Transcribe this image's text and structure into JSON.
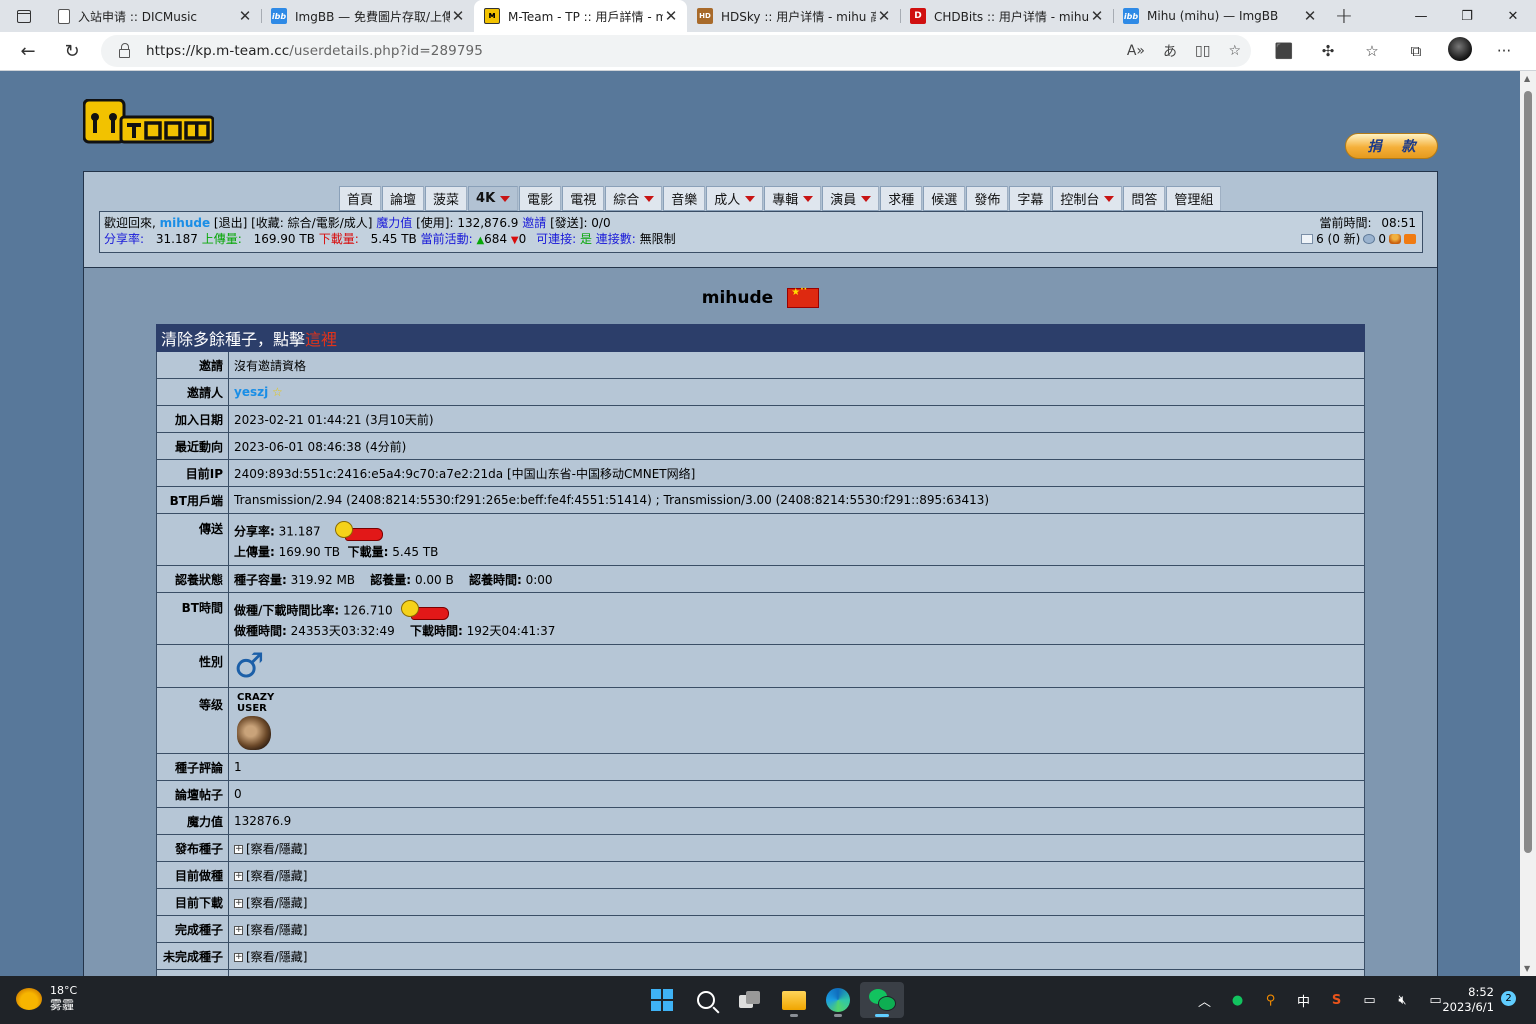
{
  "browser": {
    "tabs": [
      {
        "title": "入站申请 :: DICMusic",
        "favicon": "doc-icon",
        "active": false
      },
      {
        "title": "ImgBB — 免費圖片存取/上傳",
        "favicon": "imgbb-icon",
        "active": false
      },
      {
        "title": "M-Team - TP :: 用戶詳情 - mihude",
        "favicon": "mteam-icon",
        "active": true
      },
      {
        "title": "HDSky :: 用户详情 - mihu 高清",
        "favicon": "hdsky-icon",
        "active": false
      },
      {
        "title": "CHDBits :: 用户详情 - mihu",
        "favicon": "chdbits-icon",
        "active": false
      },
      {
        "title": "Mihu (mihu) — ImgBB",
        "favicon": "imgbb-icon",
        "active": false
      }
    ],
    "url_host": "https://kp.m-team.cc",
    "url_path": "/userdetails.php?id=289795"
  },
  "site": {
    "donate_a": "捐",
    "donate_b": "款",
    "menu": [
      {
        "label": "首頁",
        "dropdown": false,
        "selected": false
      },
      {
        "label": "論壇",
        "dropdown": false,
        "selected": false
      },
      {
        "label": "菠菜",
        "dropdown": false,
        "selected": false
      },
      {
        "label": "4K",
        "dropdown": true,
        "selected": true
      },
      {
        "label": "電影",
        "dropdown": false,
        "selected": false
      },
      {
        "label": "電視",
        "dropdown": false,
        "selected": false
      },
      {
        "label": "綜合",
        "dropdown": true,
        "selected": false
      },
      {
        "label": "音樂",
        "dropdown": false,
        "selected": false
      },
      {
        "label": "成人",
        "dropdown": true,
        "selected": false
      },
      {
        "label": "專輯",
        "dropdown": true,
        "selected": false
      },
      {
        "label": "演員",
        "dropdown": true,
        "selected": false
      },
      {
        "label": "求種",
        "dropdown": false,
        "selected": false
      },
      {
        "label": "候選",
        "dropdown": false,
        "selected": false
      },
      {
        "label": "發佈",
        "dropdown": false,
        "selected": false
      },
      {
        "label": "字幕",
        "dropdown": false,
        "selected": false
      },
      {
        "label": "控制台",
        "dropdown": true,
        "selected": false
      },
      {
        "label": "問答",
        "dropdown": false,
        "selected": false
      },
      {
        "label": "管理組",
        "dropdown": false,
        "selected": false
      }
    ]
  },
  "infobar": {
    "welcome": "歡迎回來,",
    "username": "mihude",
    "logout": "[退出]",
    "fav": "[收藏: 綜合/電影/成人]",
    "bonus_label": "魔力值",
    "bonus_used": "[使用]: 132,876.9",
    "invite_label": "邀請",
    "invite_sent": "[發送]: 0/0",
    "ratio_label": "分享率:",
    "ratio": "31.187",
    "up_label": "上傳量:",
    "up": "169.90 TB",
    "down_label": "下載量:",
    "down": "5.45 TB",
    "active_label": "當前活動:",
    "seeding": "684",
    "leeching": "0",
    "connectable_label": "可連接:",
    "connectable": "是",
    "conn_label": "連接數:",
    "conn": "無限制",
    "time_label": "當前時間:",
    "time": "08:51",
    "messages": "6 (0 新)",
    "friends": "0"
  },
  "profile": {
    "name": "mihude",
    "header_text": "清除多餘種子，點擊",
    "header_link": "這裡",
    "rows": {
      "invite_label": "邀請",
      "invite": "沒有邀請資格",
      "inviter_label": "邀請人",
      "inviter": "yeszj",
      "join_label": "加入日期",
      "join": "2023-02-21 01:44:21 (3月10天前)",
      "last_label": "最近動向",
      "last": "2023-06-01 08:46:38 (4分前)",
      "ip_label": "目前IP",
      "ip": "2409:893d:551c:2416:e5a4:9c70:a7e2:21da [中国山东省-中国移动CMNET网络]",
      "client_label": "BT用戶端",
      "client": "Transmission/2.94 (2408:8214:5530:f291:265e:beff:fe4f:4551:51414) ; Transmission/3.00 (2408:8214:5530:f291::895:63413)",
      "transfer_label": "傳送",
      "t_ratio_label": "分享率:",
      "t_ratio": "31.187",
      "t_up_label": "上傳量:",
      "t_up": "169.90 TB",
      "t_down_label": "下載量:",
      "t_down": "5.45 TB",
      "adopt_label": "認養狀態",
      "a_size_label": "種子容量:",
      "a_size": "319.92 MB",
      "a_amt_label": "認養量:",
      "a_amt": "0.00 B",
      "a_time_label": "認養時間:",
      "a_time": "0:00",
      "bt_label": "BT時間",
      "bt_ratio_label": "做種/下載時間比率:",
      "bt_ratio": "126.710",
      "bt_seed_label": "做種時間:",
      "bt_seed": "24353天03:32:49",
      "bt_dl_label": "下載時間:",
      "bt_dl": "192天04:41:37",
      "gender_label": "性別",
      "gender_symbol": "♂",
      "class_label": "等级",
      "class_text": "CRAZY USER",
      "comments_label": "種子評論",
      "comments": "1",
      "posts_label": "論壇帖子",
      "posts": "0",
      "bonus_label": "魔力值",
      "bonus": "132876.9",
      "uploaded_label": "發布種子",
      "seeding_label": "目前做種",
      "leeching_label": "目前下載",
      "completed_label": "完成種子",
      "incomplete_label": "未完成種子",
      "toggle": "[察看/隱藏]"
    }
  },
  "taskbar": {
    "temp": "18°C",
    "weather": "雾霾",
    "ime": "中",
    "time": "8:52",
    "date": "2023/6/1",
    "notifications": "2"
  }
}
